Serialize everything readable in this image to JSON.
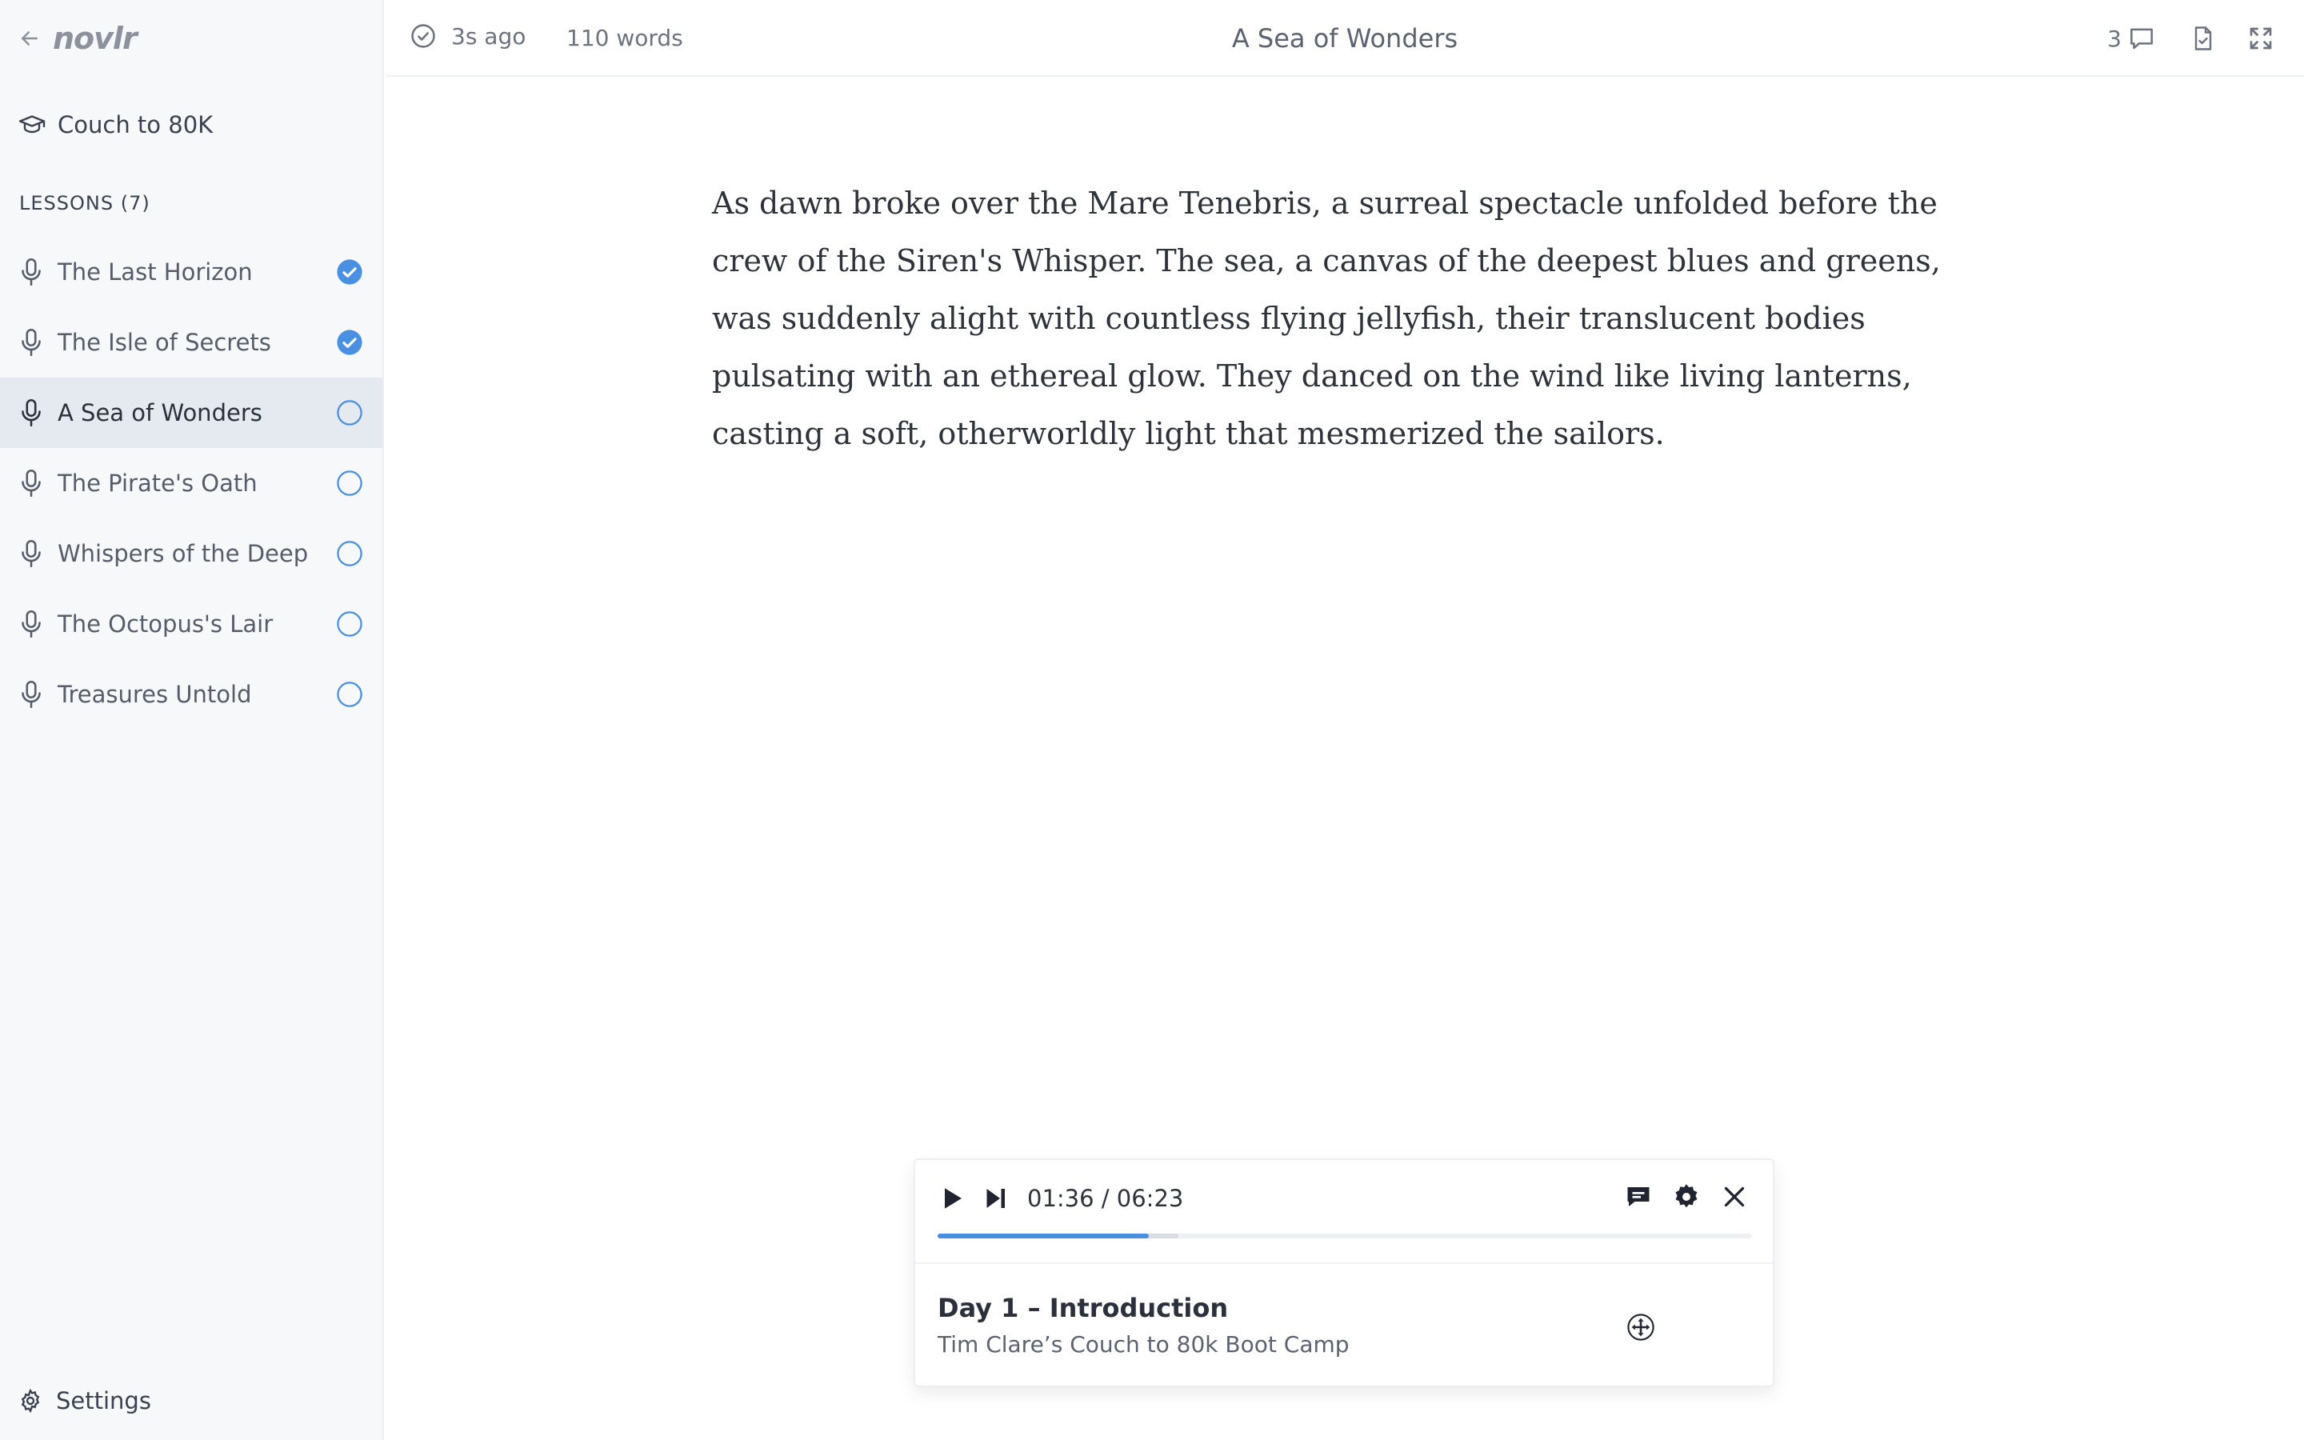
{
  "sidebar": {
    "brand": "novlr",
    "course": "Couch to 80K",
    "lessons_heading": "LESSONS (7)",
    "lessons": [
      {
        "label": "The Last Horizon",
        "done": true,
        "active": false
      },
      {
        "label": "The Isle of Secrets",
        "done": true,
        "active": false
      },
      {
        "label": "A Sea of Wonders",
        "done": false,
        "active": true
      },
      {
        "label": "The Pirate's Oath",
        "done": false,
        "active": false
      },
      {
        "label": "Whispers of the Deep",
        "done": false,
        "active": false
      },
      {
        "label": "The Octopus's Lair",
        "done": false,
        "active": false
      },
      {
        "label": "Treasures Untold",
        "done": false,
        "active": false
      }
    ],
    "settings": "Settings"
  },
  "topbar": {
    "saved": "3s ago",
    "word_count": "110 words",
    "title": "A Sea of Wonders",
    "comment_count": "3"
  },
  "editor": {
    "text": "As dawn broke over the Mare Tenebris, a surreal spectacle unfolded before the crew of the Siren's Whisper. The sea, a canvas of the deepest blues and greens, was suddenly alight with countless flying jellyfish, their translucent bodies pulsating with an ethereal glow. They danced on the wind like living lanterns, casting a soft, otherworldly light that mesmerized the sailors."
  },
  "player": {
    "time": "01:36 / 06:23",
    "progress": 0.259,
    "buffered": 0.296,
    "title": "Day 1 – Introduction",
    "subtitle": "Tim Clare’s Couch to 80k Boot Camp"
  },
  "colors": {
    "accent": "#4a90e2",
    "sidebar_bg": "#f7f8fa",
    "active_row": "#e5e9f0"
  },
  "icons": [
    "back-arrow-icon",
    "graduation-cap-icon",
    "microphone-icon",
    "check-circle-icon",
    "empty-circle-icon",
    "gear-icon",
    "comment-icon",
    "document-check-icon",
    "fullscreen-icon",
    "play-icon",
    "skip-next-icon",
    "chat-icon",
    "close-icon",
    "move-icon"
  ]
}
